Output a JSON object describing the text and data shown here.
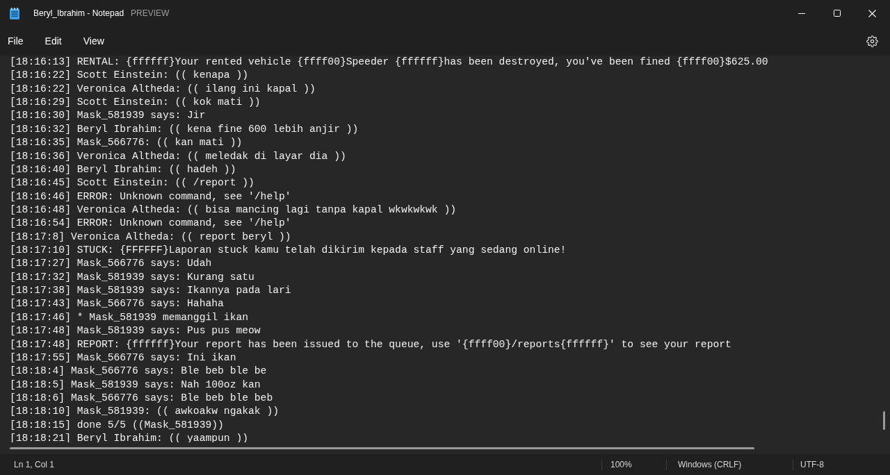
{
  "window": {
    "title": "Beryl_Ibrahim - Notepad",
    "badge": "PREVIEW"
  },
  "menu": [
    "File",
    "Edit",
    "View"
  ],
  "editor": {
    "lines": [
      "[18:16:13] RENTAL: {ffffff}Your rented vehicle {ffff00}Speeder {ffffff}has been destroyed, you've been fined {ffff00}$625.00",
      "[18:16:22] Scott Einstein: (( kenapa ))",
      "[18:16:22] Veronica Altheda: (( ilang ini kapal ))",
      "[18:16:29] Scott Einstein: (( kok mati ))",
      "[18:16:30] Mask_581939 says: Jir",
      "[18:16:32] Beryl Ibrahim: (( kena fine 600 lebih anjir ))",
      "[18:16:35] Mask_566776: (( kan mati ))",
      "[18:16:36] Veronica Altheda: (( meledak di layar dia ))",
      "[18:16:40] Beryl Ibrahim: (( hadeh ))",
      "[18:16:45] Scott Einstein: (( /report ))",
      "[18:16:46] ERROR: Unknown command, see '/help'",
      "[18:16:48] Veronica Altheda: (( bisa mancing lagi tanpa kapal wkwkwkwk ))",
      "[18:16:54] ERROR: Unknown command, see '/help'",
      "[18:17:8] Veronica Altheda: (( report beryl ))",
      "[18:17:10] STUCK: {FFFFFF}Laporan stuck kamu telah dikirim kepada staff yang sedang online!",
      "[18:17:27] Mask_566776 says: Udah",
      "[18:17:32] Mask_581939 says: Kurang satu",
      "[18:17:38] Mask_581939 says: Ikannya pada lari",
      "[18:17:43] Mask_566776 says: Hahaha",
      "[18:17:46] * Mask_581939 memanggil ikan",
      "[18:17:48] Mask_581939 says: Pus pus meow",
      "[18:17:48] REPORT: {ffffff}Your report has been issued to the queue, use '{ffff00}/reports{ffffff}' to see your report",
      "[18:17:55] Mask_566776 says: Ini ikan",
      "[18:18:4] Mask_566776 says: Ble beb ble be",
      "[18:18:5] Mask_581939 says: Nah 100oz kan",
      "[18:18:6] Mask_566776 says: Ble beb ble beb",
      "[18:18:10] Mask_581939: (( awkoakw ngakak ))",
      "[18:18:15] done 5/5 ((Mask_581939))",
      "[18:18:21] Beryl Ibrahim: (( yaampun ))"
    ]
  },
  "status_bar": {
    "position": "Ln 1, Col 1",
    "zoom": "100%",
    "line_ending": "Windows (CRLF)",
    "encoding": "UTF-8"
  }
}
